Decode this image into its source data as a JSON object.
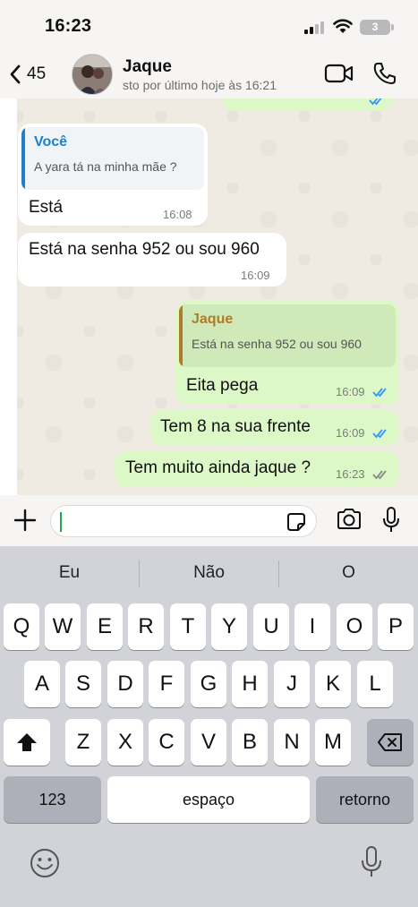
{
  "status_bar": {
    "time": "16:23",
    "battery_level": "3"
  },
  "header": {
    "back_count": "45",
    "contact_name": "Jaque",
    "contact_status": "sto por último hoje às 16:21"
  },
  "messages": [
    {
      "direction": "in",
      "quote_author": "Você",
      "quote_text": "A yara tá na minha mãe ?",
      "text": "Está",
      "time": "16:08"
    },
    {
      "direction": "in",
      "text": "Está na senha 952 ou sou 960",
      "time": "16:09"
    },
    {
      "direction": "out",
      "quote_author": "Jaque",
      "quote_text": "Está na senha 952 ou sou 960",
      "text": "Eita pega",
      "time": "16:09",
      "ticks": "read"
    },
    {
      "direction": "out",
      "text": "Tem 8 na sua frente",
      "time": "16:09",
      "ticks": "read"
    },
    {
      "direction": "out",
      "text": "Tem muito ainda jaque ?",
      "time": "16:23",
      "ticks": "delivered"
    }
  ],
  "input": {
    "value": "",
    "placeholder": ""
  },
  "keyboard": {
    "suggestions": [
      "Eu",
      "Não",
      "O"
    ],
    "row1": [
      "Q",
      "W",
      "E",
      "R",
      "T",
      "Y",
      "U",
      "I",
      "O",
      "P"
    ],
    "row2": [
      "A",
      "S",
      "D",
      "F",
      "G",
      "H",
      "J",
      "K",
      "L"
    ],
    "row3": [
      "Z",
      "X",
      "C",
      "V",
      "B",
      "N",
      "M"
    ],
    "numbers_label": "123",
    "space_label": "espaço",
    "return_label": "retorno"
  },
  "icons": {
    "back": "chevron-left-icon",
    "video": "video-call-icon",
    "call": "phone-icon",
    "plus": "plus-icon",
    "sticker": "sticker-icon",
    "camera": "camera-icon",
    "mic": "microphone-icon",
    "shift": "shift-icon",
    "delete": "backspace-icon",
    "emoji": "emoji-icon",
    "dictation": "dictation-icon"
  },
  "colors": {
    "outgoing_bubble": "#dcf8c6",
    "incoming_bubble": "#ffffff",
    "quote_you": "#1f7fc9",
    "quote_contact": "#b07a2a",
    "read_ticks": "#3797f0",
    "caret": "#1ea952"
  }
}
